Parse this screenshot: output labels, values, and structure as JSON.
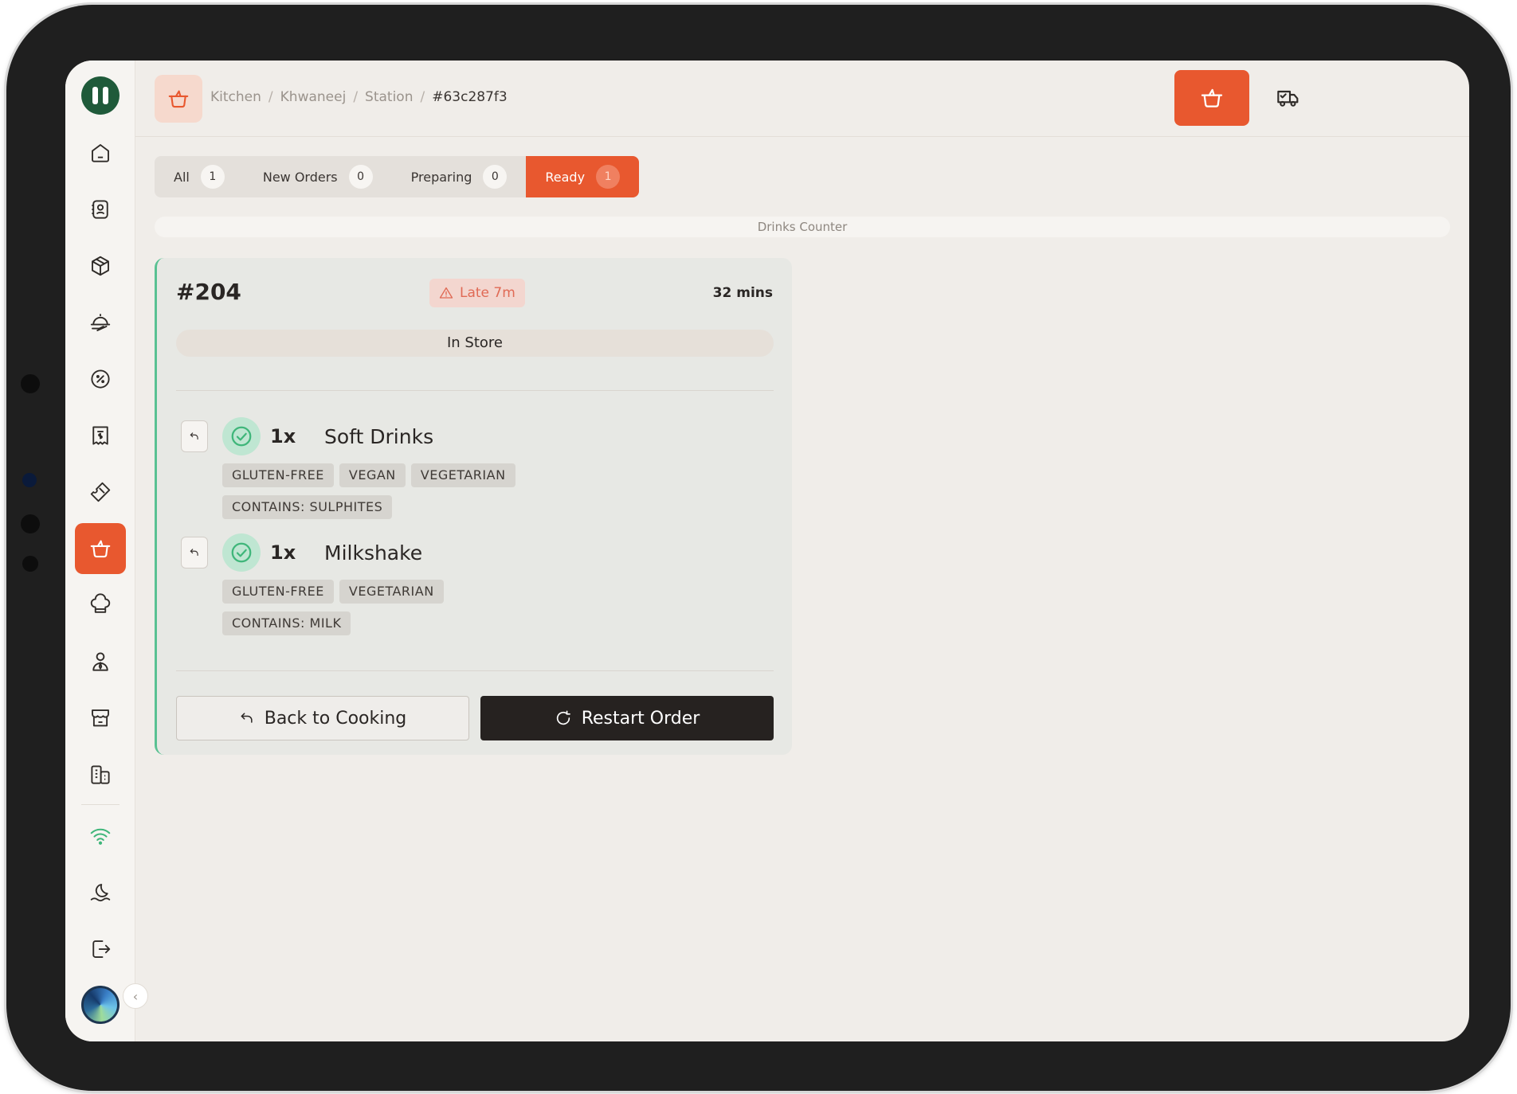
{
  "breadcrumb": {
    "items": [
      "Kitchen",
      "Khwaneej",
      "Station"
    ],
    "current": "#63c287f3",
    "separator": "/"
  },
  "tabs": [
    {
      "label": "All",
      "count": "1"
    },
    {
      "label": "New Orders",
      "count": "0"
    },
    {
      "label": "Preparing",
      "count": "0"
    },
    {
      "label": "Ready",
      "count": "1"
    }
  ],
  "station": {
    "name": "Drinks Counter"
  },
  "order": {
    "number": "#204",
    "late_label": "Late 7m",
    "elapsed": "32 mins",
    "type": "In Store",
    "items": [
      {
        "qty": "1x",
        "name": "Soft Drinks",
        "tags": [
          "GLUTEN-FREE",
          "VEGAN",
          "VEGETARIAN"
        ],
        "allergens": [
          "CONTAINS: SULPHITES"
        ]
      },
      {
        "qty": "1x",
        "name": "Milkshake",
        "tags": [
          "GLUTEN-FREE",
          "VEGETARIAN"
        ],
        "allergens": [
          "CONTAINS: MILK"
        ]
      }
    ],
    "actions": {
      "back_label": "Back to Cooking",
      "restart_label": "Restart Order"
    }
  },
  "sidebar": {
    "icons": [
      "home-icon",
      "contacts-icon",
      "box-icon",
      "food-delivery-icon",
      "discount-icon",
      "receipt-icon",
      "ticket-icon",
      "kitchen-pot-icon",
      "chef-hat-icon",
      "user-tie-icon",
      "store-icon",
      "building-icon",
      "wifi-icon",
      "night-mode-icon",
      "logout-icon"
    ],
    "active": "kitchen-pot-icon"
  },
  "colors": {
    "accent": "#e8582f",
    "brand": "#1f5a3a",
    "success": "#59c192",
    "late": "#e06a55",
    "dark_button": "#262220"
  }
}
